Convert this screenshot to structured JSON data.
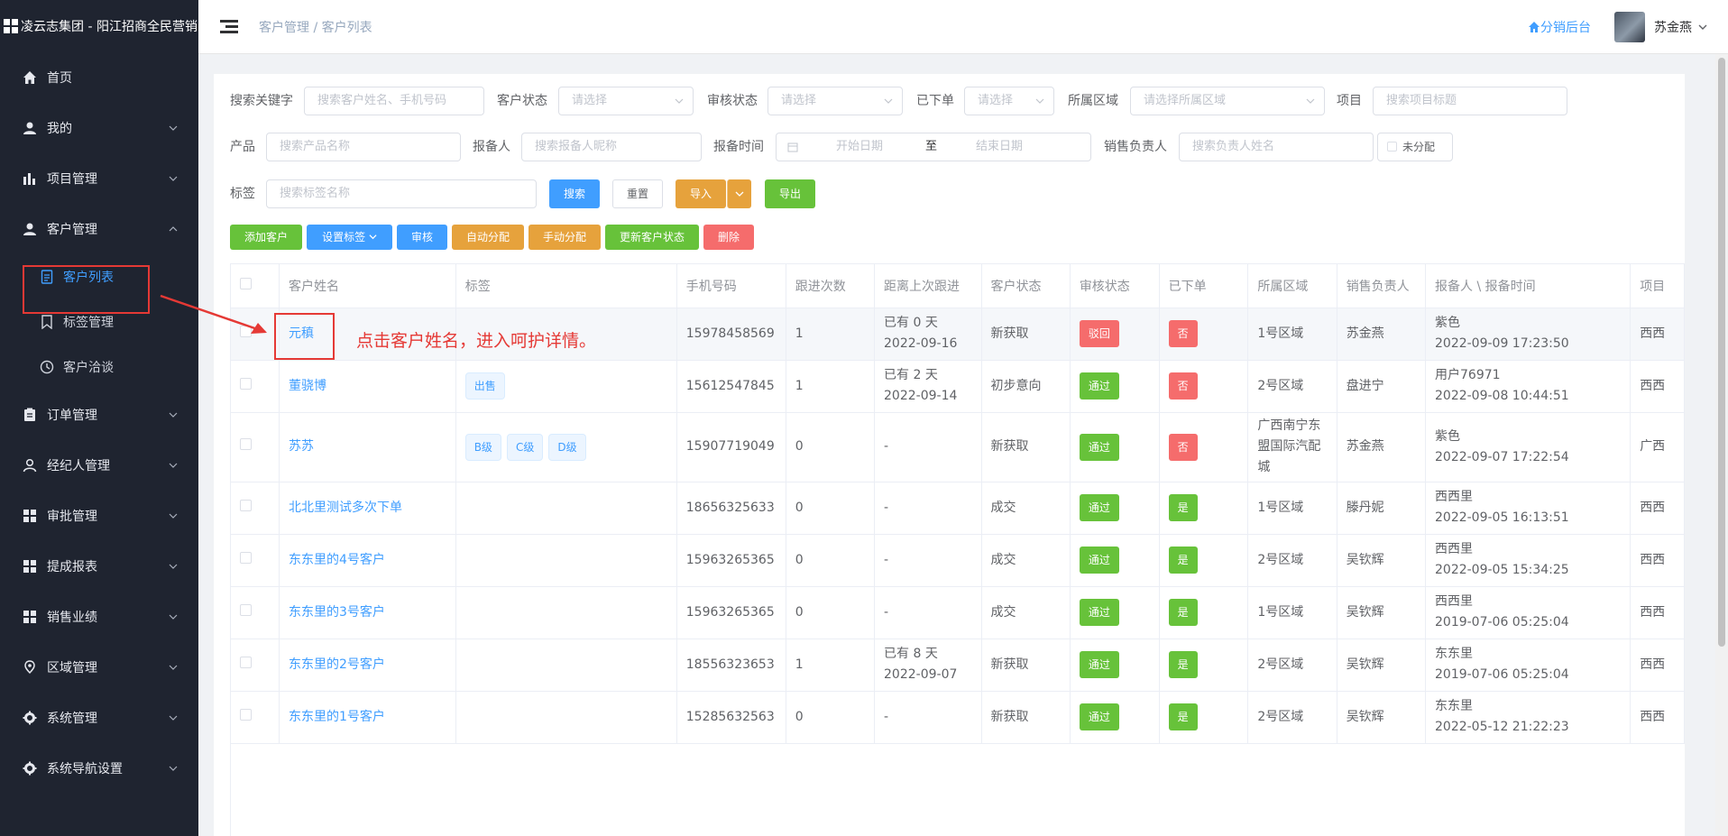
{
  "brand": {
    "title": "凌云志集团 - 阳江招商全民营销"
  },
  "sidebar": {
    "items": [
      {
        "label": "首页",
        "icon": "home-icon"
      },
      {
        "label": "我的",
        "icon": "user-icon"
      },
      {
        "label": "项目管理",
        "icon": "bar-chart-icon"
      },
      {
        "label": "客户管理",
        "icon": "user-icon"
      },
      {
        "label": "订单管理",
        "icon": "clipboard-icon"
      },
      {
        "label": "经纪人管理",
        "icon": "person-outline-icon"
      },
      {
        "label": "审批管理",
        "icon": "grid-icon"
      },
      {
        "label": "提成报表",
        "icon": "grid-icon"
      },
      {
        "label": "销售业绩",
        "icon": "grid-icon"
      },
      {
        "label": "区域管理",
        "icon": "location-icon"
      },
      {
        "label": "系统管理",
        "icon": "gear-icon"
      },
      {
        "label": "系统导航设置",
        "icon": "gear-icon"
      }
    ],
    "sub_items": [
      {
        "label": "客户列表",
        "icon": "document-icon"
      },
      {
        "label": "标签管理",
        "icon": "bookmark-icon"
      },
      {
        "label": "客户洽谈",
        "icon": "clock-icon"
      }
    ]
  },
  "header": {
    "breadcrumb_parent": "客户管理",
    "breadcrumb_sep": " / ",
    "breadcrumb_current": "客户列表",
    "dist_link": "分销后台",
    "username": "苏金燕"
  },
  "filters": {
    "keyword_label": "搜索关键字",
    "keyword_placeholder": "搜索客户姓名、手机号码",
    "status_label": "客户状态",
    "status_placeholder": "请选择",
    "audit_label": "审核状态",
    "audit_placeholder": "请选择",
    "ordered_label": "已下单",
    "ordered_placeholder": "请选择",
    "region_label": "所属区域",
    "region_placeholder": "请选择所属区域",
    "project_label": "项目",
    "project_placeholder": "搜索项目标题",
    "product_label": "产品",
    "product_placeholder": "搜索产品名称",
    "reporter_label": "报备人",
    "reporter_placeholder": "搜索报备人昵称",
    "time_label": "报备时间",
    "start_placeholder": "开始日期",
    "range_sep": "至",
    "end_placeholder": "结束日期",
    "sales_label": "销售负责人",
    "sales_placeholder": "搜索负责人姓名",
    "unassigned_label": "未分配",
    "tag_label": "标签",
    "tag_placeholder": "搜索标签名称",
    "search_btn": "搜索",
    "reset_btn": "重置",
    "import_btn": "导入",
    "export_btn": "导出"
  },
  "actions": {
    "add": "添加客户",
    "set_tags": "设置标签",
    "audit": "审核",
    "auto_assign": "自动分配",
    "manual_assign": "手动分配",
    "update_status": "更新客户状态",
    "delete": "删除"
  },
  "table": {
    "columns": [
      "客户姓名",
      "标签",
      "手机号码",
      "跟进次数",
      "距离上次跟进",
      "客户状态",
      "审核状态",
      "已下单",
      "所属区域",
      "销售负责人",
      "报备人 \\ 报备时间",
      "项目"
    ],
    "rows": [
      {
        "name": "元稹",
        "tags": [],
        "phone": "15978458569",
        "follow": "1",
        "last1": "已有 0 天",
        "last2": "2022-09-16",
        "status": "新获取",
        "audit": "驳回",
        "audit_color": "#f56c6c",
        "ordered": "否",
        "ordered_color": "#f56c6c",
        "region": "1号区域",
        "sales": "苏金燕",
        "reporter": "紫色",
        "time": "2022-09-09 17:23:50",
        "project": "西西"
      },
      {
        "name": "董骁博",
        "tags": [
          "出售"
        ],
        "phone": "15612547845",
        "follow": "1",
        "last1": "已有 2 天",
        "last2": "2022-09-14",
        "status": "初步意向",
        "audit": "通过",
        "audit_color": "#67c23a",
        "ordered": "否",
        "ordered_color": "#f56c6c",
        "region": "2号区域",
        "sales": "盘进宁",
        "reporter": "用户76971",
        "time": "2022-09-08 10:44:51",
        "project": "西西"
      },
      {
        "name": "苏苏",
        "tags": [
          "B级",
          "C级",
          "D级"
        ],
        "phone": "15907719049",
        "follow": "0",
        "last1": "-",
        "last2": "",
        "status": "新获取",
        "audit": "通过",
        "audit_color": "#67c23a",
        "ordered": "否",
        "ordered_color": "#f56c6c",
        "region": "广西南宁东盟国际汽配城",
        "sales": "苏金燕",
        "reporter": "紫色",
        "time": "2022-09-07 17:22:54",
        "project": "广西"
      },
      {
        "name": "北北里测试多次下单",
        "tags": [],
        "phone": "18656325633",
        "follow": "0",
        "last1": "-",
        "last2": "",
        "status": "成交",
        "audit": "通过",
        "audit_color": "#67c23a",
        "ordered": "是",
        "ordered_color": "#67c23a",
        "region": "1号区域",
        "sales": "滕丹妮",
        "reporter": "西西里",
        "time": "2022-09-05 16:13:51",
        "project": "西西"
      },
      {
        "name": "东东里的4号客户",
        "tags": [],
        "phone": "15963265365",
        "follow": "0",
        "last1": "-",
        "last2": "",
        "status": "成交",
        "audit": "通过",
        "audit_color": "#67c23a",
        "ordered": "是",
        "ordered_color": "#67c23a",
        "region": "2号区域",
        "sales": "吴钦辉",
        "reporter": "西西里",
        "time": "2022-09-05 15:34:25",
        "project": "西西"
      },
      {
        "name": "东东里的3号客户",
        "tags": [],
        "phone": "15963265365",
        "follow": "0",
        "last1": "-",
        "last2": "",
        "status": "成交",
        "audit": "通过",
        "audit_color": "#67c23a",
        "ordered": "是",
        "ordered_color": "#67c23a",
        "region": "1号区域",
        "sales": "吴钦辉",
        "reporter": "西西里",
        "time": "2019-07-06 05:25:04",
        "project": "西西"
      },
      {
        "name": "东东里的2号客户",
        "tags": [],
        "phone": "18556323653",
        "follow": "1",
        "last1": "已有 8 天",
        "last2": "2022-09-07",
        "status": "新获取",
        "audit": "通过",
        "audit_color": "#67c23a",
        "ordered": "是",
        "ordered_color": "#67c23a",
        "region": "2号区域",
        "sales": "吴钦辉",
        "reporter": "东东里",
        "time": "2019-07-06 05:25:04",
        "project": "西西"
      },
      {
        "name": "东东里的1号客户",
        "tags": [],
        "phone": "15285632563",
        "follow": "0",
        "last1": "-",
        "last2": "",
        "status": "新获取",
        "audit": "通过",
        "audit_color": "#67c23a",
        "ordered": "是",
        "ordered_color": "#67c23a",
        "region": "2号区域",
        "sales": "吴钦辉",
        "reporter": "东东里",
        "time": "2022-05-12 21:22:23",
        "project": "西西"
      }
    ]
  },
  "annotation": {
    "text": "点击客户姓名，进入呵护详情。",
    "color": "#e53935"
  }
}
